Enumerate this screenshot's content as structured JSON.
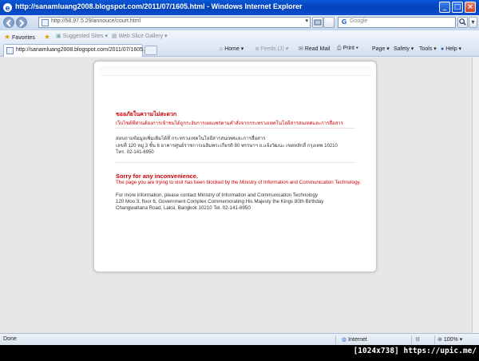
{
  "window": {
    "title": "http://sanamluang2008.blogspot.com/2011/07/1605.html - Windows Internet Explorer"
  },
  "address_bar": {
    "url": "http://58.97.5.29/annouce/court.html",
    "search_placeholder": "Google"
  },
  "favorites_bar": {
    "favorites_label": "Favorites",
    "suggested_sites": "Suggested Sites ▾",
    "web_slice_gallery": "Web Slice Gallery ▾"
  },
  "tab": {
    "title": "http://sanamluang2008.blogspot.com/2011/07/1605...."
  },
  "command_bar": {
    "home": "Home ▾",
    "feeds": "Feeds (J) ▾",
    "read_mail": "Read Mail",
    "print": "Print ▾",
    "page": "Page ▾",
    "safety": "Safety ▾",
    "tools": "Tools ▾",
    "help": "Help ▾"
  },
  "content": {
    "thai_heading": "ขออภัยในความไม่สะดวก",
    "thai_subheading": "เว็บไซต์ที่ท่านต้องการเข้าชมได้ถูกระงับการเผยแพร่ตามคำสั่งจากกระทรวงเทคโนโลยีสารสนเทศและการสื่อสาร",
    "thai_info_1": "สอบถามข้อมูลเพิ่มเติมได้ที่ กระทรวงเทคโนโลยีสารสนเทศและการสื่อสาร",
    "thai_info_2": "เลขที่ 120 หมู่ 3 ชั้น 6 อาคารศูนย์ราชการเฉลิมพระเกียรติ 80 พรรษาฯ ถ.แจ้งวัฒนะ เขตหลักสี่ กรุงเทพ 10210",
    "thai_info_3": "โทร. 02-141-6950",
    "en_heading": "Sorry for any inconvenience.",
    "en_subheading": "The page you are trying to visit has been blocked by the Ministry of Information and Communication Technology.",
    "en_info_1": "For more information, please contact Ministry of Information and Communication Technology",
    "en_info_2": "120 Moo 3, floor 6, Government Complex Commemorating His Majesty the Kings 80th Birthday",
    "en_info_3": "Changwattana Road, Laksi, Bangkok 10210 Tel. 02-141-6950"
  },
  "status_bar": {
    "left": "Done",
    "zone": "Internet",
    "zoom": "100%"
  },
  "caption": "[1024x738] https://upic.me/"
}
